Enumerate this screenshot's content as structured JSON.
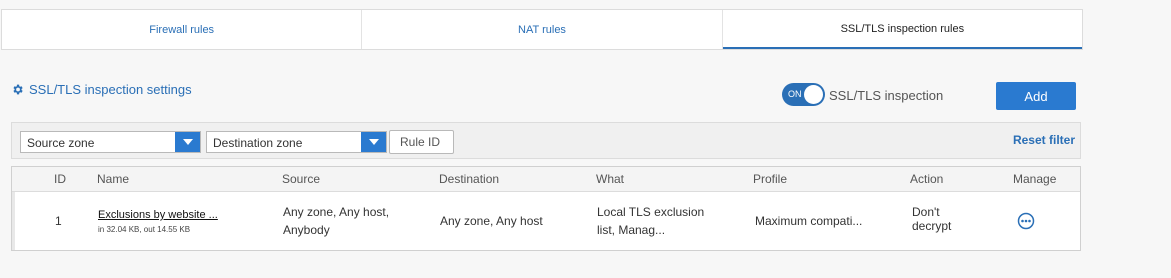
{
  "tabs": [
    {
      "label": "Firewall rules",
      "active": false
    },
    {
      "label": "NAT rules",
      "active": false
    },
    {
      "label": "SSL/TLS inspection rules",
      "active": true
    }
  ],
  "settings": {
    "label": "SSL/TLS inspection settings",
    "icon": "gear-icon"
  },
  "toggle": {
    "state_label": "ON",
    "label": "SSL/TLS inspection",
    "on": true
  },
  "add_button": {
    "label": "Add"
  },
  "filters": {
    "source_zone": "Source zone",
    "destination_zone": "Destination zone",
    "rule_id_placeholder": "Rule ID",
    "reset_label": "Reset filter"
  },
  "table": {
    "columns": [
      "ID",
      "Name",
      "Source",
      "Destination",
      "What",
      "Profile",
      "Action",
      "Manage"
    ],
    "rows": [
      {
        "id": "1",
        "name": "Exclusions by website ...",
        "traffic": "in 32.04 KB, out 14.55 KB",
        "source_line1": "Any zone, Any host,",
        "source_line2": "Anybody",
        "destination": "Any zone, Any host",
        "what_line1": "Local TLS exclusion",
        "what_line2": "list, Manag...",
        "profile": "Maximum compati...",
        "action_line1": "Don't",
        "action_line2": "decrypt",
        "manage_icon": "more-options-icon"
      }
    ]
  },
  "colors": {
    "accent": "#2a7ad0",
    "link": "#2a6fb6"
  }
}
